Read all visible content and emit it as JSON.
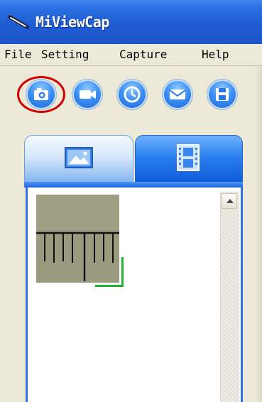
{
  "window": {
    "title": "MiViewCap",
    "app_icon": "pen-icon"
  },
  "menu": {
    "items": [
      "File",
      "Setting",
      "Capture",
      "Help"
    ]
  },
  "toolbar": {
    "buttons": [
      {
        "icon": "camera-icon",
        "highlighted": true
      },
      {
        "icon": "video-camera-icon"
      },
      {
        "icon": "clock-icon"
      },
      {
        "icon": "mail-icon"
      },
      {
        "icon": "save-icon"
      }
    ],
    "highlight_color": "#d40000"
  },
  "tabs": [
    {
      "icon": "image-icon",
      "active": true
    },
    {
      "icon": "film-icon",
      "active": false
    }
  ],
  "gallery": {
    "thumbnails": [
      {
        "name": "ruler-scale-capture",
        "selected": true
      }
    ],
    "selection_color": "#23b42f"
  },
  "colors": {
    "titlebar": "#1f5cd2",
    "menubar": "#ece9d8",
    "tab_accent": "#2f74e6"
  }
}
